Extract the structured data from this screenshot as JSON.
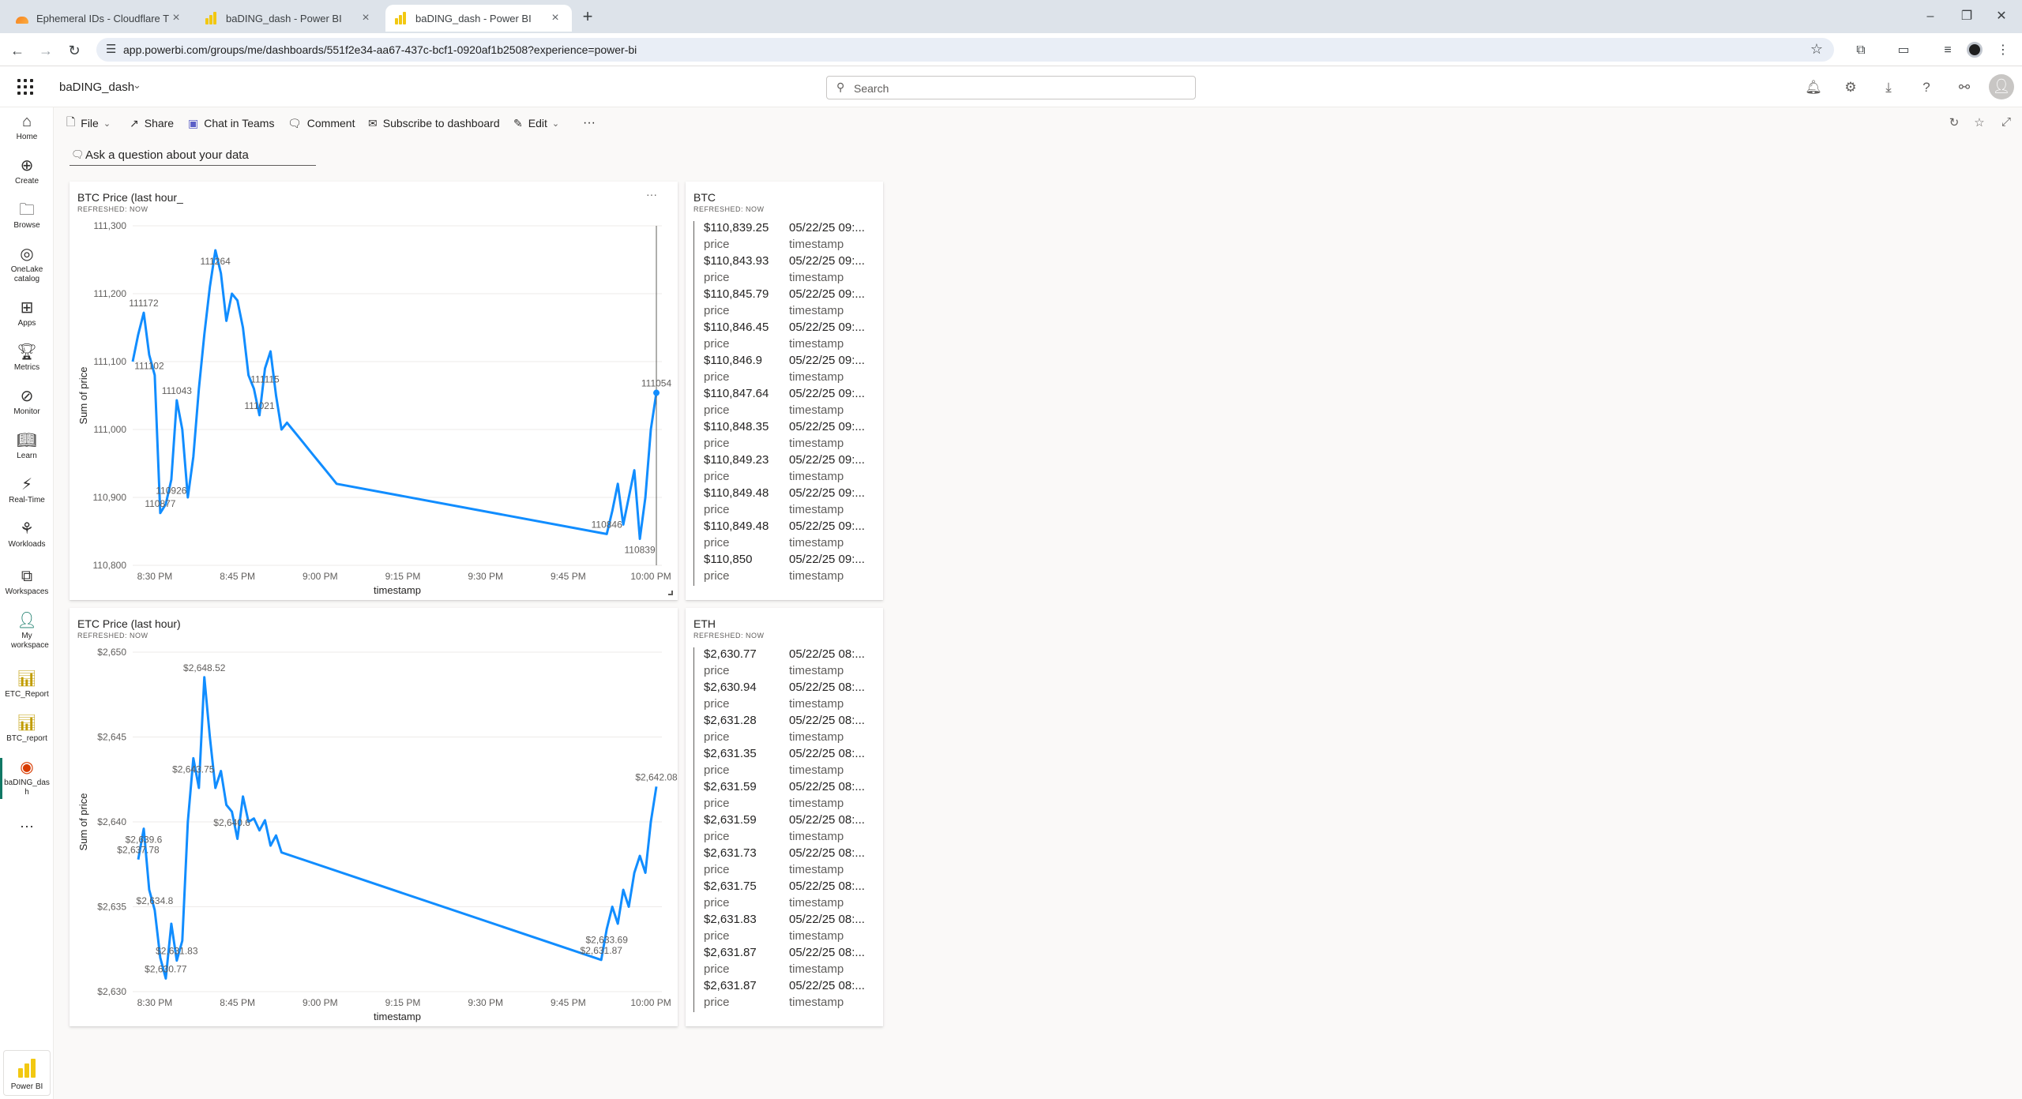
{
  "browser": {
    "tabs": [
      {
        "title": "Ephemeral IDs - Cloudflare Turns",
        "icon": "cloudflare-icon"
      },
      {
        "title": "baDING_dash - Power BI",
        "icon": "powerbi-icon"
      },
      {
        "title": "baDING_dash - Power BI",
        "icon": "powerbi-icon"
      }
    ],
    "url": "app.powerbi.com/groups/me/dashboards/551f2e34-aa67-437c-bcf1-0920af1b2508?experience=power-bi"
  },
  "header": {
    "workspace_title": "baDING_dash",
    "search_placeholder": "Search"
  },
  "leftnav": [
    {
      "label": "Home",
      "icon": "home-icon"
    },
    {
      "label": "Create",
      "icon": "create-icon"
    },
    {
      "label": "Browse",
      "icon": "browse-icon"
    },
    {
      "label": "OneLake catalog",
      "icon": "onelake-icon"
    },
    {
      "label": "Apps",
      "icon": "apps-icon"
    },
    {
      "label": "Metrics",
      "icon": "metrics-icon"
    },
    {
      "label": "Monitor",
      "icon": "monitor-icon"
    },
    {
      "label": "Learn",
      "icon": "learn-icon"
    },
    {
      "label": "Real-Time",
      "icon": "realtime-icon"
    },
    {
      "label": "Workloads",
      "icon": "workloads-icon"
    },
    {
      "label": "Workspaces",
      "icon": "workspaces-icon"
    },
    {
      "label": "My workspace",
      "icon": "my-workspace-icon"
    },
    {
      "label": "ETC_Report",
      "icon": "report-icon"
    },
    {
      "label": "BTC_report",
      "icon": "report-icon"
    },
    {
      "label": "baDING_dash",
      "icon": "dashboard-icon"
    }
  ],
  "brand": {
    "label": "Power BI",
    "accent": "#f2c811"
  },
  "commands": {
    "file": "File",
    "share": "Share",
    "chat": "Chat in Teams",
    "comment": "Comment",
    "subscribe": "Subscribe to dashboard",
    "edit": "Edit"
  },
  "qna": {
    "placeholder": "Ask a question about your data"
  },
  "tiles": {
    "btc_chart": {
      "title": "BTC Price (last hour_",
      "subtitle": "REFRESHED: NOW"
    },
    "etc_chart": {
      "title": "ETC Price (last hour)",
      "subtitle": "REFRESHED: NOW"
    },
    "btc_table": {
      "title": "BTC",
      "subtitle": "REFRESHED: NOW",
      "rows": [
        {
          "value": "$110,839.25",
          "value_label": "price",
          "time": "05/22/25 09:...",
          "time_label": "timestamp"
        },
        {
          "value": "$110,843.93",
          "value_label": "price",
          "time": "05/22/25 09:...",
          "time_label": "timestamp"
        },
        {
          "value": "$110,845.79",
          "value_label": "price",
          "time": "05/22/25 09:...",
          "time_label": "timestamp"
        },
        {
          "value": "$110,846.45",
          "value_label": "price",
          "time": "05/22/25 09:...",
          "time_label": "timestamp"
        },
        {
          "value": "$110,846.9",
          "value_label": "price",
          "time": "05/22/25 09:...",
          "time_label": "timestamp"
        },
        {
          "value": "$110,847.64",
          "value_label": "price",
          "time": "05/22/25 09:...",
          "time_label": "timestamp"
        },
        {
          "value": "$110,848.35",
          "value_label": "price",
          "time": "05/22/25 09:...",
          "time_label": "timestamp"
        },
        {
          "value": "$110,849.23",
          "value_label": "price",
          "time": "05/22/25 09:...",
          "time_label": "timestamp"
        },
        {
          "value": "$110,849.48",
          "value_label": "price",
          "time": "05/22/25 09:...",
          "time_label": "timestamp"
        },
        {
          "value": "$110,849.48",
          "value_label": "price",
          "time": "05/22/25 09:...",
          "time_label": "timestamp"
        },
        {
          "value": "$110,850",
          "value_label": "price",
          "time": "05/22/25 09:...",
          "time_label": "timestamp"
        }
      ]
    },
    "eth_table": {
      "title": "ETH",
      "subtitle": "REFRESHED: NOW",
      "rows": [
        {
          "value": "$2,630.77",
          "value_label": "price",
          "time": "05/22/25 08:...",
          "time_label": "timestamp"
        },
        {
          "value": "$2,630.94",
          "value_label": "price",
          "time": "05/22/25 08:...",
          "time_label": "timestamp"
        },
        {
          "value": "$2,631.28",
          "value_label": "price",
          "time": "05/22/25 08:...",
          "time_label": "timestamp"
        },
        {
          "value": "$2,631.35",
          "value_label": "price",
          "time": "05/22/25 08:...",
          "time_label": "timestamp"
        },
        {
          "value": "$2,631.59",
          "value_label": "price",
          "time": "05/22/25 08:...",
          "time_label": "timestamp"
        },
        {
          "value": "$2,631.59",
          "value_label": "price",
          "time": "05/22/25 08:...",
          "time_label": "timestamp"
        },
        {
          "value": "$2,631.73",
          "value_label": "price",
          "time": "05/22/25 08:...",
          "time_label": "timestamp"
        },
        {
          "value": "$2,631.75",
          "value_label": "price",
          "time": "05/22/25 08:...",
          "time_label": "timestamp"
        },
        {
          "value": "$2,631.83",
          "value_label": "price",
          "time": "05/22/25 08:...",
          "time_label": "timestamp"
        },
        {
          "value": "$2,631.87",
          "value_label": "price",
          "time": "05/22/25 08:...",
          "time_label": "timestamp"
        },
        {
          "value": "$2,631.87",
          "value_label": "price",
          "time": "05/22/25 08:...",
          "time_label": "timestamp"
        }
      ]
    }
  },
  "chart_data": [
    {
      "type": "line",
      "title": "BTC Price (last hour_",
      "xlabel": "timestamp",
      "ylabel": "Sum of price",
      "color": "#118dff",
      "xlim": [
        "8:26 PM",
        "10:02 PM"
      ],
      "ylim": [
        110800,
        111300
      ],
      "x_ticks": [
        "8:30 PM",
        "8:45 PM",
        "9:00 PM",
        "9:15 PM",
        "9:30 PM",
        "9:45 PM",
        "10:00 PM"
      ],
      "y_ticks": [
        "110,800",
        "110,900",
        "111,000",
        "111,100",
        "111,200",
        "111,300"
      ],
      "grid": true,
      "series": [
        {
          "x": [
            "8:26 PM",
            "8:27 PM",
            "8:28 PM",
            "8:29 PM",
            "8:30 PM",
            "8:31 PM",
            "8:32 PM",
            "8:33 PM",
            "8:34 PM",
            "8:35 PM",
            "8:36 PM",
            "8:37 PM",
            "8:38 PM",
            "8:39 PM",
            "8:40 PM",
            "8:41 PM",
            "8:42 PM",
            "8:43 PM",
            "8:44 PM",
            "8:45 PM",
            "8:46 PM",
            "8:47 PM",
            "8:48 PM",
            "8:49 PM",
            "8:50 PM",
            "8:51 PM",
            "8:52 PM",
            "8:53 PM",
            "8:54 PM",
            "8:55 PM",
            "8:56 PM",
            "8:57 PM",
            "8:58 PM",
            "8:59 PM",
            "9:00 PM",
            "9:01 PM",
            "9:02 PM",
            "9:03 PM",
            "9:52 PM",
            "9:53 PM",
            "9:54 PM",
            "9:55 PM",
            "9:56 PM",
            "9:57 PM",
            "9:58 PM",
            "9:59 PM",
            "10:00 PM",
            "10:01 PM"
          ],
          "values": [
            111100,
            111140,
            111172,
            111110,
            111080,
            110877,
            110890,
            110926,
            111043,
            111000,
            110900,
            110960,
            111060,
            111140,
            111210,
            111264,
            111230,
            111160,
            111200,
            111190,
            111150,
            111080,
            111060,
            111021,
            111090,
            111115,
            111050,
            111000,
            111010,
            111000,
            110990,
            110980,
            110970,
            110960,
            110950,
            110940,
            110930,
            110920,
            110846,
            110880,
            110920,
            110860,
            110900,
            110940,
            110839,
            110900,
            111000,
            111054
          ]
        }
      ],
      "data_labels": [
        {
          "x": "8:28 PM",
          "text": "111172"
        },
        {
          "x": "8:29 PM",
          "text": "111102"
        },
        {
          "x": "8:31 PM",
          "text": "110877"
        },
        {
          "x": "8:33 PM",
          "text": "110926"
        },
        {
          "x": "8:34 PM",
          "text": "111043"
        },
        {
          "x": "8:41 PM",
          "text": "111264"
        },
        {
          "x": "8:49 PM",
          "text": "111021"
        },
        {
          "x": "8:50 PM",
          "text": "111115"
        },
        {
          "x": "9:52 PM",
          "text": "110846"
        },
        {
          "x": "9:58 PM",
          "text": "110839"
        },
        {
          "x": "10:01 PM",
          "text": "111054"
        }
      ]
    },
    {
      "type": "line",
      "title": "ETC Price (last hour)",
      "xlabel": "timestamp",
      "ylabel": "Sum of price",
      "color": "#118dff",
      "xlim": [
        "8:26 PM",
        "10:02 PM"
      ],
      "ylim": [
        2630,
        2650
      ],
      "x_ticks": [
        "8:30 PM",
        "8:45 PM",
        "9:00 PM",
        "9:15 PM",
        "9:30 PM",
        "9:45 PM",
        "10:00 PM"
      ],
      "y_ticks": [
        "$2,630",
        "$2,635",
        "$2,640",
        "$2,645",
        "$2,650"
      ],
      "grid": true,
      "series": [
        {
          "x": [
            "8:27 PM",
            "8:28 PM",
            "8:29 PM",
            "8:30 PM",
            "8:31 PM",
            "8:32 PM",
            "8:33 PM",
            "8:34 PM",
            "8:35 PM",
            "8:36 PM",
            "8:37 PM",
            "8:38 PM",
            "8:39 PM",
            "8:40 PM",
            "8:41 PM",
            "8:42 PM",
            "8:43 PM",
            "8:44 PM",
            "8:45 PM",
            "8:46 PM",
            "8:47 PM",
            "8:48 PM",
            "8:49 PM",
            "8:50 PM",
            "8:51 PM",
            "8:52 PM",
            "8:53 PM",
            "9:51 PM",
            "9:52 PM",
            "9:53 PM",
            "9:54 PM",
            "9:55 PM",
            "9:56 PM",
            "9:57 PM",
            "9:58 PM",
            "9:59 PM",
            "10:00 PM",
            "10:01 PM"
          ],
          "values": [
            2637.78,
            2639.6,
            2636,
            2634.8,
            2632,
            2630.77,
            2634,
            2631.83,
            2633,
            2640,
            2643.75,
            2642,
            2648.52,
            2645,
            2642,
            2643,
            2641,
            2640.6,
            2639,
            2641.5,
            2640,
            2640.2,
            2639.5,
            2640.1,
            2638.6,
            2639.2,
            2638.2,
            2631.87,
            2633.69,
            2635,
            2634,
            2636,
            2635,
            2637,
            2638,
            2637,
            2640,
            2642.08
          ]
        }
      ],
      "data_labels": [
        {
          "x": "8:27 PM",
          "text": "$2,637.78"
        },
        {
          "x": "8:28 PM",
          "text": "$2,639.6"
        },
        {
          "x": "8:30 PM",
          "text": "$2,634.8"
        },
        {
          "x": "8:32 PM",
          "text": "$2,630.77"
        },
        {
          "x": "8:34 PM",
          "text": "$2,631.83"
        },
        {
          "x": "8:37 PM",
          "text": "$2,643.75"
        },
        {
          "x": "8:39 PM",
          "text": "$2,648.52"
        },
        {
          "x": "8:44 PM",
          "text": "$2,640.6"
        },
        {
          "x": "9:51 PM",
          "text": "$2,631.87"
        },
        {
          "x": "9:52 PM",
          "text": "$2,633.69"
        },
        {
          "x": "10:01 PM",
          "text": "$2,642.08"
        }
      ]
    }
  ]
}
